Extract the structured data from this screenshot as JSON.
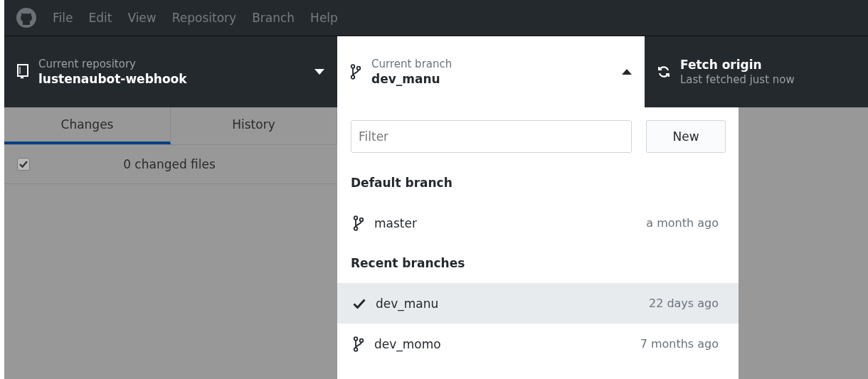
{
  "menu": [
    "File",
    "Edit",
    "View",
    "Repository",
    "Branch",
    "Help"
  ],
  "repository": {
    "label": "Current repository",
    "name": "lustenaubot-webhook"
  },
  "branch": {
    "label": "Current branch",
    "name": "dev_manu",
    "expanded": true
  },
  "fetch": {
    "title": "Fetch origin",
    "subtitle": "Last fetched just now"
  },
  "tabs": [
    {
      "label": "Changes",
      "selected": true
    },
    {
      "label": "History",
      "selected": false
    }
  ],
  "changes": {
    "label": "0 changed files",
    "checked": true
  },
  "branch_list": {
    "filter": {
      "placeholder": "Filter"
    },
    "new_button": "New",
    "sections": [
      {
        "title": "Default branch",
        "items": [
          {
            "name": "master",
            "time": "a month ago",
            "selected": false
          }
        ]
      },
      {
        "title": "Recent branches",
        "items": [
          {
            "name": "dev_manu",
            "time": "22 days ago",
            "selected": true
          },
          {
            "name": "dev_momo",
            "time": "7 months ago",
            "selected": false
          }
        ]
      }
    ]
  }
}
